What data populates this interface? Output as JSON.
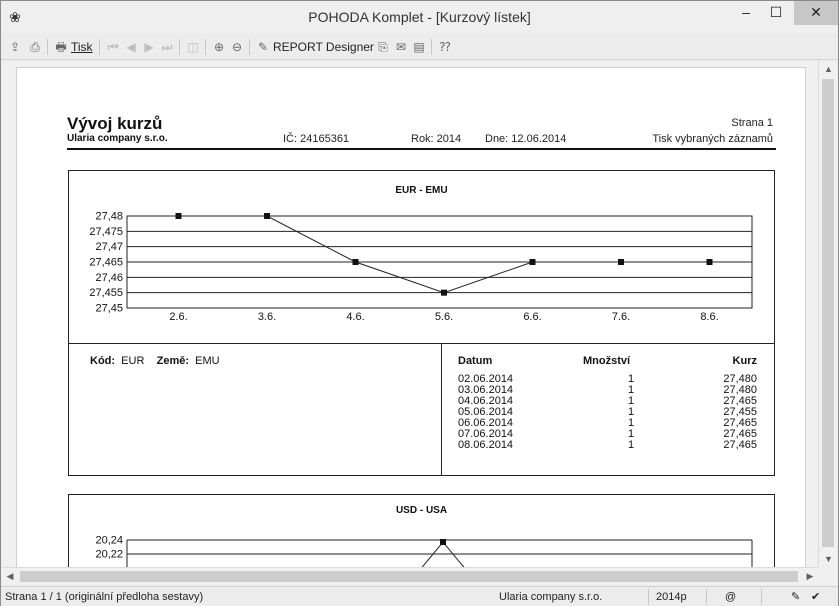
{
  "window": {
    "title": "POHODA Komplet - [Kurzový lístek]",
    "minimize": "–",
    "maximize": "☐",
    "close": "✕"
  },
  "toolbar": {
    "print_label": "Tisk",
    "report_designer_label": "REPORT Designer"
  },
  "report": {
    "title": "Vývoj kurzů",
    "company": "Ularia company s.r.o.",
    "ic": "IČ: 24165361",
    "rok": "Rok: 2014",
    "dne": "Dne: 12.06.2014",
    "strana": "Strana 1",
    "tisk": "Tisk vybraných záznamů",
    "sections": [
      {
        "chart_title": "EUR - EMU",
        "kod_label": "Kód:",
        "kod_value": "EUR",
        "zeme_label": "Země:",
        "zeme_value": "EMU",
        "col_datum": "Datum",
        "col_mnozstvi": "Množství",
        "col_kurz": "Kurz",
        "rows": [
          {
            "datum": "02.06.2014",
            "mnozstvi": "1",
            "kurz": "27,480"
          },
          {
            "datum": "03.06.2014",
            "mnozstvi": "1",
            "kurz": "27,480"
          },
          {
            "datum": "04.06.2014",
            "mnozstvi": "1",
            "kurz": "27,465"
          },
          {
            "datum": "05.06.2014",
            "mnozstvi": "1",
            "kurz": "27,455"
          },
          {
            "datum": "06.06.2014",
            "mnozstvi": "1",
            "kurz": "27,465"
          },
          {
            "datum": "07.06.2014",
            "mnozstvi": "1",
            "kurz": "27,465"
          },
          {
            "datum": "08.06.2014",
            "mnozstvi": "1",
            "kurz": "27,465"
          }
        ]
      },
      {
        "chart_title": "USD - USA"
      }
    ]
  },
  "statusbar": {
    "page_info": "Strana 1 / 1  (originální předloha sestavy)",
    "company": "Ularia company s.r.o.",
    "year": "2014p",
    "at": "@"
  },
  "chart_data": [
    {
      "type": "line",
      "title": "EUR - EMU",
      "categories": [
        "2.6.",
        "3.6.",
        "4.6.",
        "5.6.",
        "6.6.",
        "7.6.",
        "8.6."
      ],
      "values": [
        27.48,
        27.48,
        27.465,
        27.455,
        27.465,
        27.465,
        27.465
      ],
      "yticks": [
        "27,48",
        "27,475",
        "27,47",
        "27,465",
        "27,46",
        "27,455",
        "27,45"
      ],
      "ylim": [
        27.45,
        27.48
      ],
      "grid": true
    },
    {
      "type": "line",
      "title": "USD - USA",
      "yticks": [
        "20,24",
        "20,22"
      ],
      "partial": true
    }
  ]
}
